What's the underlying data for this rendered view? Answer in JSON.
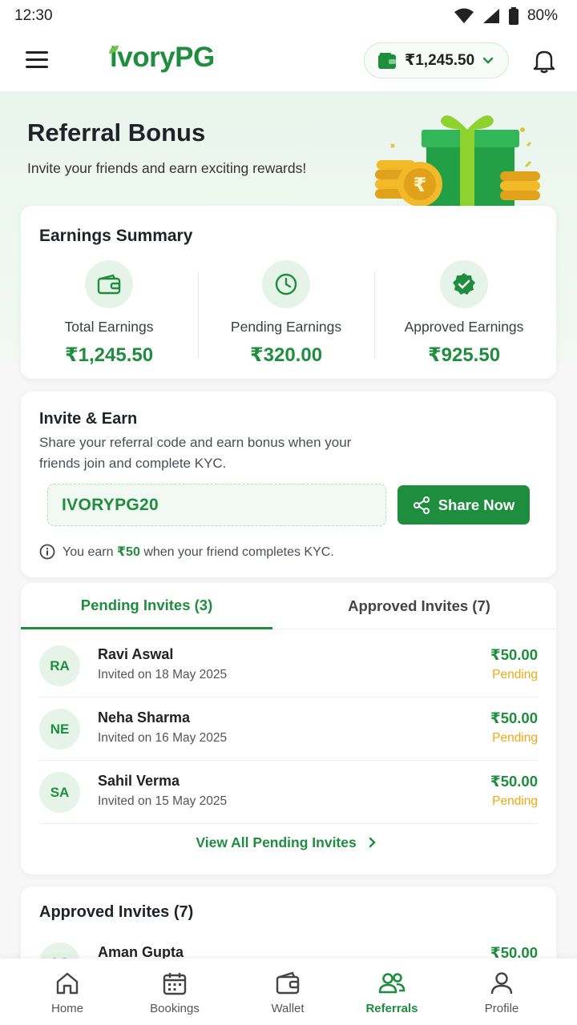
{
  "status_bar": {
    "time": "12:30",
    "battery": "80%"
  },
  "header": {
    "logo": "ivoryPG",
    "wallet_balance": "₹1,245.50"
  },
  "hero": {
    "title": "Referral Bonus",
    "subtitle": "Invite your friends and earn exciting rewards!"
  },
  "summary": {
    "title": "Earnings Summary",
    "stats": [
      {
        "label": "Total Earnings",
        "value": "₹1,245.50",
        "icon": "wallet-icon"
      },
      {
        "label": "Pending Earnings",
        "value": "₹320.00",
        "icon": "clock-icon"
      },
      {
        "label": "Approved Earnings",
        "value": "₹925.50",
        "icon": "verified-badge-icon"
      }
    ]
  },
  "invite": {
    "title": "Invite & Earn",
    "description": "Share your referral code and earn bonus when your friends join and complete KYC.",
    "code": "IVORYPG20",
    "share_label": "Share Now",
    "note_prefix": "You earn",
    "note_amount": "₹50",
    "note_suffix": "when your friend completes KYC."
  },
  "invites": {
    "tabs": [
      {
        "label": "Pending Invites (3)",
        "active": true
      },
      {
        "label": "Approved Invites (7)",
        "active": false
      }
    ],
    "rows": [
      {
        "initials": "RA",
        "name": "Ravi Aswal",
        "date": "Invited on 18 May 2025",
        "amount": "₹50.00",
        "status": "Pending"
      },
      {
        "initials": "NE",
        "name": "Neha Sharma",
        "date": "Invited on 16 May 2025",
        "amount": "₹50.00",
        "status": "Pending"
      },
      {
        "initials": "SA",
        "name": "Sahil Verma",
        "date": "Invited on 15 May 2025",
        "amount": "₹50.00",
        "status": "Pending"
      }
    ],
    "view_all": "View All Pending Invites"
  },
  "approved": {
    "title": "Approved Invites (7)",
    "rows": [
      {
        "initials": "AG",
        "name": "Aman Gupta",
        "amount": "₹50.00"
      }
    ]
  },
  "nav": [
    {
      "label": "Home",
      "icon": "home-icon",
      "active": false
    },
    {
      "label": "Bookings",
      "icon": "calendar-icon",
      "active": false
    },
    {
      "label": "Wallet",
      "icon": "wallet-icon",
      "active": false
    },
    {
      "label": "Referrals",
      "icon": "users-icon",
      "active": true
    },
    {
      "label": "Profile",
      "icon": "user-icon",
      "active": false
    }
  ],
  "colors": {
    "brand": "#1e8e3e",
    "pending": "#f0a814",
    "hero_bg": "#e9f5ec"
  }
}
